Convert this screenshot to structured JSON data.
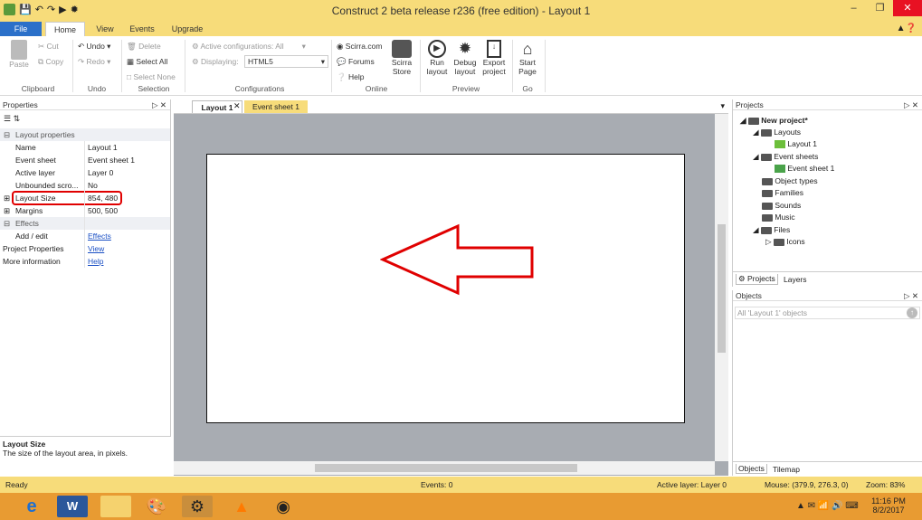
{
  "window": {
    "title": "Construct 2 beta release r236  (free edition) - Layout 1"
  },
  "ribbon_tabs": [
    "File",
    "Home",
    "View",
    "Events",
    "Upgrade"
  ],
  "clipboard": {
    "paste": "Paste",
    "cut": "Cut",
    "copy": "Copy",
    "group": "Clipboard"
  },
  "undo": {
    "undo": "Undo",
    "redo": "Redo",
    "group": "Undo"
  },
  "selection": {
    "delete": "Delete",
    "select_all": "Select All",
    "select_none": "Select None",
    "group": "Selection"
  },
  "configurations": {
    "active_label": "Active configurations: All",
    "displaying_label": "Displaying:",
    "displaying_value": "HTML5",
    "group": "Configurations"
  },
  "online": {
    "scirra": "Scirra.com",
    "forums": "Forums",
    "help": "Help",
    "store_l1": "Scirra",
    "store_l2": "Store",
    "group": "Online"
  },
  "preview": {
    "run_l1": "Run",
    "run_l2": "layout",
    "debug_l1": "Debug",
    "debug_l2": "layout",
    "export_l1": "Export",
    "export_l2": "project",
    "group": "Preview"
  },
  "go": {
    "start_l1": "Start",
    "start_l2": "Page",
    "group": "Go"
  },
  "properties": {
    "title": "Properties",
    "category_layout": "Layout properties",
    "rows": [
      {
        "k": "Name",
        "v": "Layout 1"
      },
      {
        "k": "Event sheet",
        "v": "Event sheet 1"
      },
      {
        "k": "Active layer",
        "v": "Layer 0"
      },
      {
        "k": "Unbounded scro...",
        "v": "No"
      },
      {
        "k": "Layout Size",
        "v": "854, 480"
      },
      {
        "k": "Margins",
        "v": "500, 500"
      }
    ],
    "category_effects": "Effects",
    "effects_k": "Add / edit",
    "effects_v": "Effects",
    "project_k": "Project Properties",
    "project_v": "View",
    "info_k": "More information",
    "info_v": "Help",
    "desc_title": "Layout Size",
    "desc_text": "The size of the layout area, in pixels."
  },
  "doc_tabs": [
    "Layout 1",
    "Event sheet 1"
  ],
  "projects": {
    "title": "Projects",
    "root": "New project*",
    "layouts": "Layouts",
    "layout1": "Layout 1",
    "eventsheets": "Event sheets",
    "eventsheet1": "Event sheet 1",
    "objecttypes": "Object types",
    "families": "Families",
    "sounds": "Sounds",
    "music": "Music",
    "files": "Files",
    "icons": "Icons",
    "tab_projects": "Projects",
    "tab_layers": "Layers"
  },
  "objects": {
    "title": "Objects",
    "filter": "All 'Layout 1' objects",
    "tab_objects": "Objects",
    "tab_tilemap": "Tilemap"
  },
  "status": {
    "ready": "Ready",
    "events": "Events: 0",
    "active_layer": "Active layer: Layer 0",
    "mouse": "Mouse: (379.9, 276.3, 0)",
    "zoom": "Zoom: 83%"
  },
  "clock": {
    "time": "11:16 PM",
    "date": "8/2/2017"
  },
  "colors": {
    "accent_bar": "#f7dc7a",
    "file_tab": "#2b70c9",
    "highlight": "#e00000",
    "taskbar": "#e89b32"
  }
}
